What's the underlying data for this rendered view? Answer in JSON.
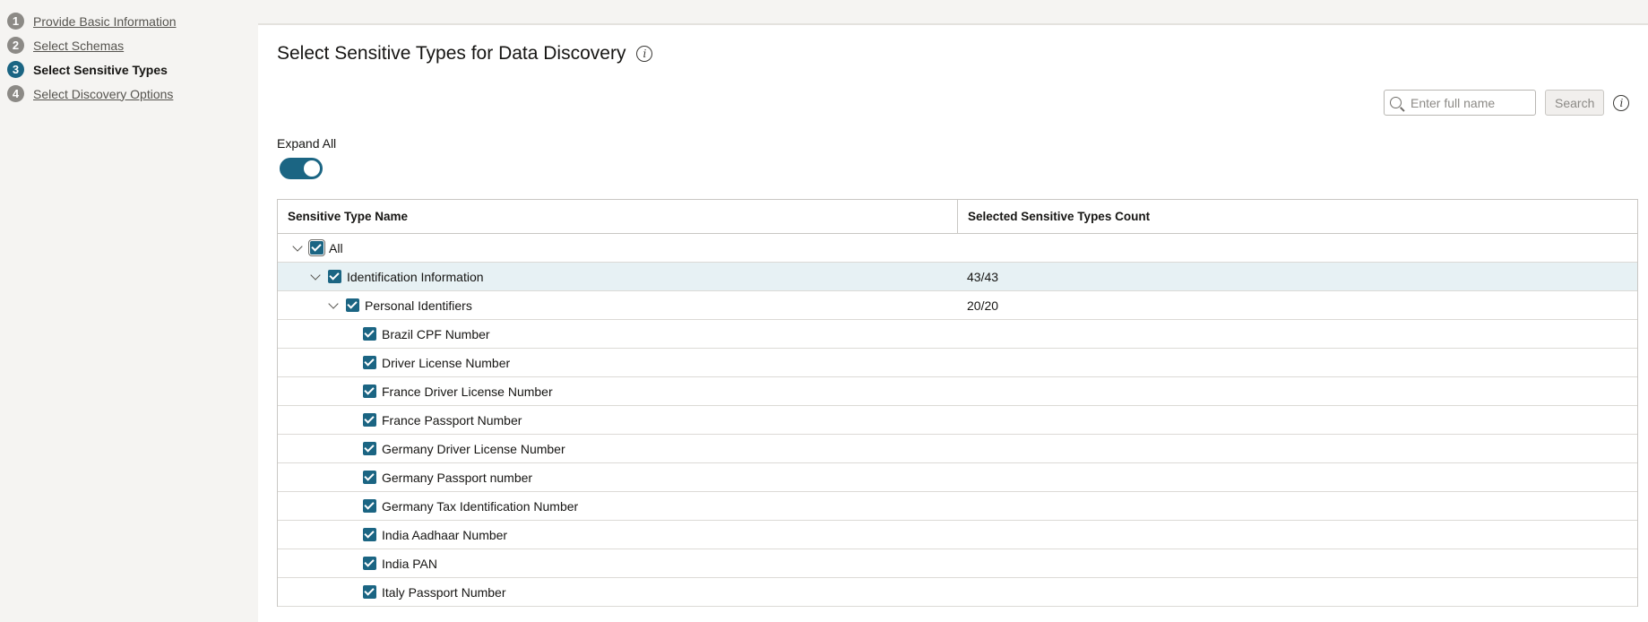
{
  "train": {
    "steps": [
      {
        "num": "1",
        "label": "Provide Basic Information"
      },
      {
        "num": "2",
        "label": "Select Schemas"
      },
      {
        "num": "3",
        "label": "Select Sensitive Types"
      },
      {
        "num": "4",
        "label": "Select Discovery Options"
      }
    ],
    "current_step": 3
  },
  "page": {
    "title": "Select Sensitive Types for Data Discovery",
    "info_icon": "info-icon"
  },
  "search": {
    "placeholder": "Enter full name",
    "value": "",
    "button_label": "Search"
  },
  "expand_all": {
    "label": "Expand All",
    "on": true
  },
  "table": {
    "columns": [
      "Sensitive Type Name",
      "Selected Sensitive Types Count"
    ],
    "rows": [
      {
        "level": 0,
        "expandable": true,
        "label": "All",
        "count": "",
        "checked": true
      },
      {
        "level": 1,
        "expandable": true,
        "label": "Identification Information",
        "count": "43/43",
        "checked": true
      },
      {
        "level": 2,
        "expandable": true,
        "label": "Personal Identifiers",
        "count": "20/20",
        "checked": true
      },
      {
        "level": 3,
        "expandable": false,
        "label": "Brazil CPF Number",
        "count": "",
        "checked": true
      },
      {
        "level": 3,
        "expandable": false,
        "label": "Driver License Number",
        "count": "",
        "checked": true
      },
      {
        "level": 3,
        "expandable": false,
        "label": "France Driver License Number",
        "count": "",
        "checked": true
      },
      {
        "level": 3,
        "expandable": false,
        "label": "France Passport Number",
        "count": "",
        "checked": true
      },
      {
        "level": 3,
        "expandable": false,
        "label": "Germany Driver License Number",
        "count": "",
        "checked": true
      },
      {
        "level": 3,
        "expandable": false,
        "label": "Germany Passport number",
        "count": "",
        "checked": true
      },
      {
        "level": 3,
        "expandable": false,
        "label": "Germany Tax Identification Number",
        "count": "",
        "checked": true
      },
      {
        "level": 3,
        "expandable": false,
        "label": "India Aadhaar Number",
        "count": "",
        "checked": true
      },
      {
        "level": 3,
        "expandable": false,
        "label": "India PAN",
        "count": "",
        "checked": true
      },
      {
        "level": 3,
        "expandable": false,
        "label": "Italy Passport Number",
        "count": "",
        "checked": true
      }
    ]
  },
  "colors": {
    "accent": "#1b6583",
    "row_highlight": "#e7f1f4",
    "background": "#f5f4f2"
  }
}
